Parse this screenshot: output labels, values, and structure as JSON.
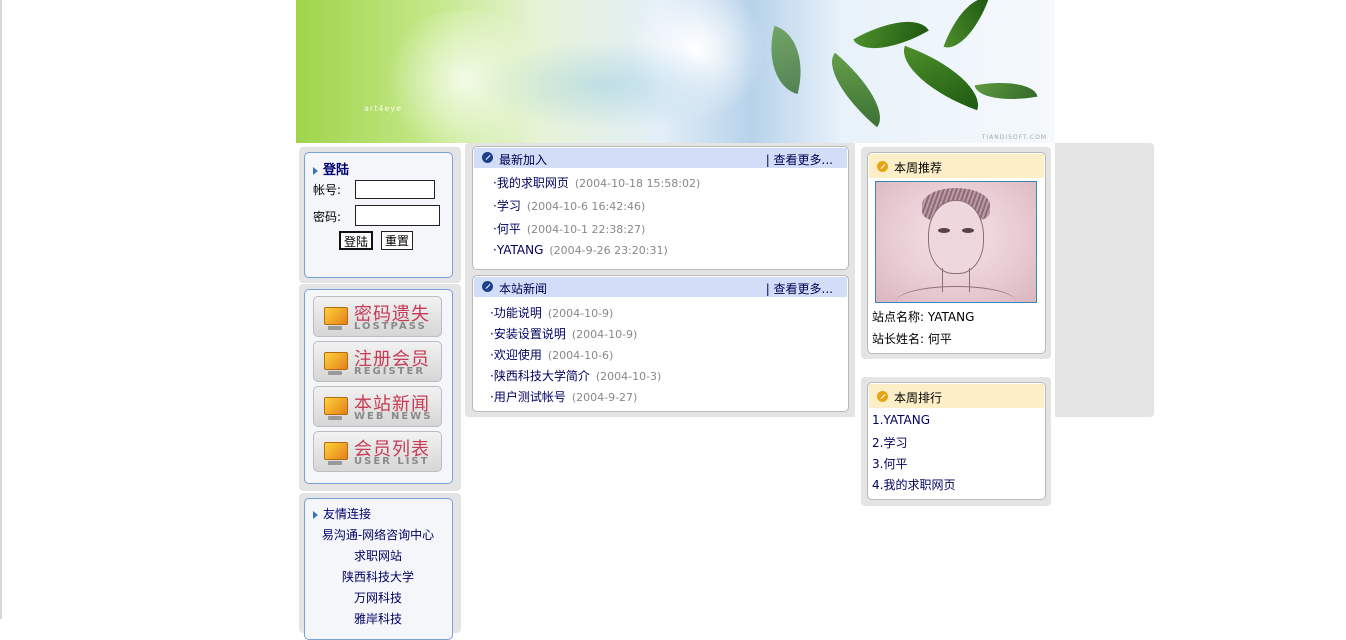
{
  "banner": {
    "signature": "art4eye",
    "mark": "TIANDISOFT.COM"
  },
  "login": {
    "title": "登陆",
    "username_label": "帐号:",
    "password_label": "密码:",
    "submit_label": "登陆",
    "reset_label": "重置"
  },
  "menu": [
    {
      "cn": "密码遗失",
      "en": "LOSTPASS"
    },
    {
      "cn": "注册会员",
      "en": "REGISTER"
    },
    {
      "cn": "本站新闻",
      "en": "WEB NEWS"
    },
    {
      "cn": "会员列表",
      "en": "USER LIST"
    }
  ],
  "friends": {
    "title": "友情连接",
    "links": [
      "易沟通-网络咨询中心",
      "求职网站",
      "陕西科技大学",
      "万网科技",
      "雅岸科技"
    ]
  },
  "latest": {
    "title": "最新加入",
    "more": "| 查看更多...",
    "items": [
      {
        "title": "·我的求职网页",
        "date": "(2004-10-18 15:58:02)"
      },
      {
        "title": "·学习",
        "date": "(2004-10-6 16:42:46)"
      },
      {
        "title": "·何平",
        "date": "(2004-10-1 22:38:27)"
      },
      {
        "title": "·YATANG",
        "date": "(2004-9-26 23:20:31)"
      }
    ]
  },
  "news": {
    "title": "本站新闻",
    "more": "| 查看更多...",
    "items": [
      {
        "title": "·功能说明",
        "date": "(2004-10-9)"
      },
      {
        "title": "·安装设置说明",
        "date": "(2004-10-9)"
      },
      {
        "title": "·欢迎使用",
        "date": "(2004-10-6)"
      },
      {
        "title": "·陕西科技大学简介",
        "date": "(2004-10-3)"
      },
      {
        "title": "·用户测试帐号",
        "date": "(2004-9-27)"
      }
    ]
  },
  "recommend": {
    "title": "本周推荐",
    "site_name": "站点名称: YATANG",
    "owner_name": "站长姓名: 何平"
  },
  "ranking": {
    "title": "本周排行",
    "items": [
      "1.YATANG",
      "2.学习",
      "3.何平",
      "4.我的求职网页"
    ]
  },
  "colors": {
    "accent_blue": "#7aa0d8",
    "header_blue": "#d2def8",
    "header_gold": "#fcefc8",
    "menu_red": "#c73b55"
  }
}
